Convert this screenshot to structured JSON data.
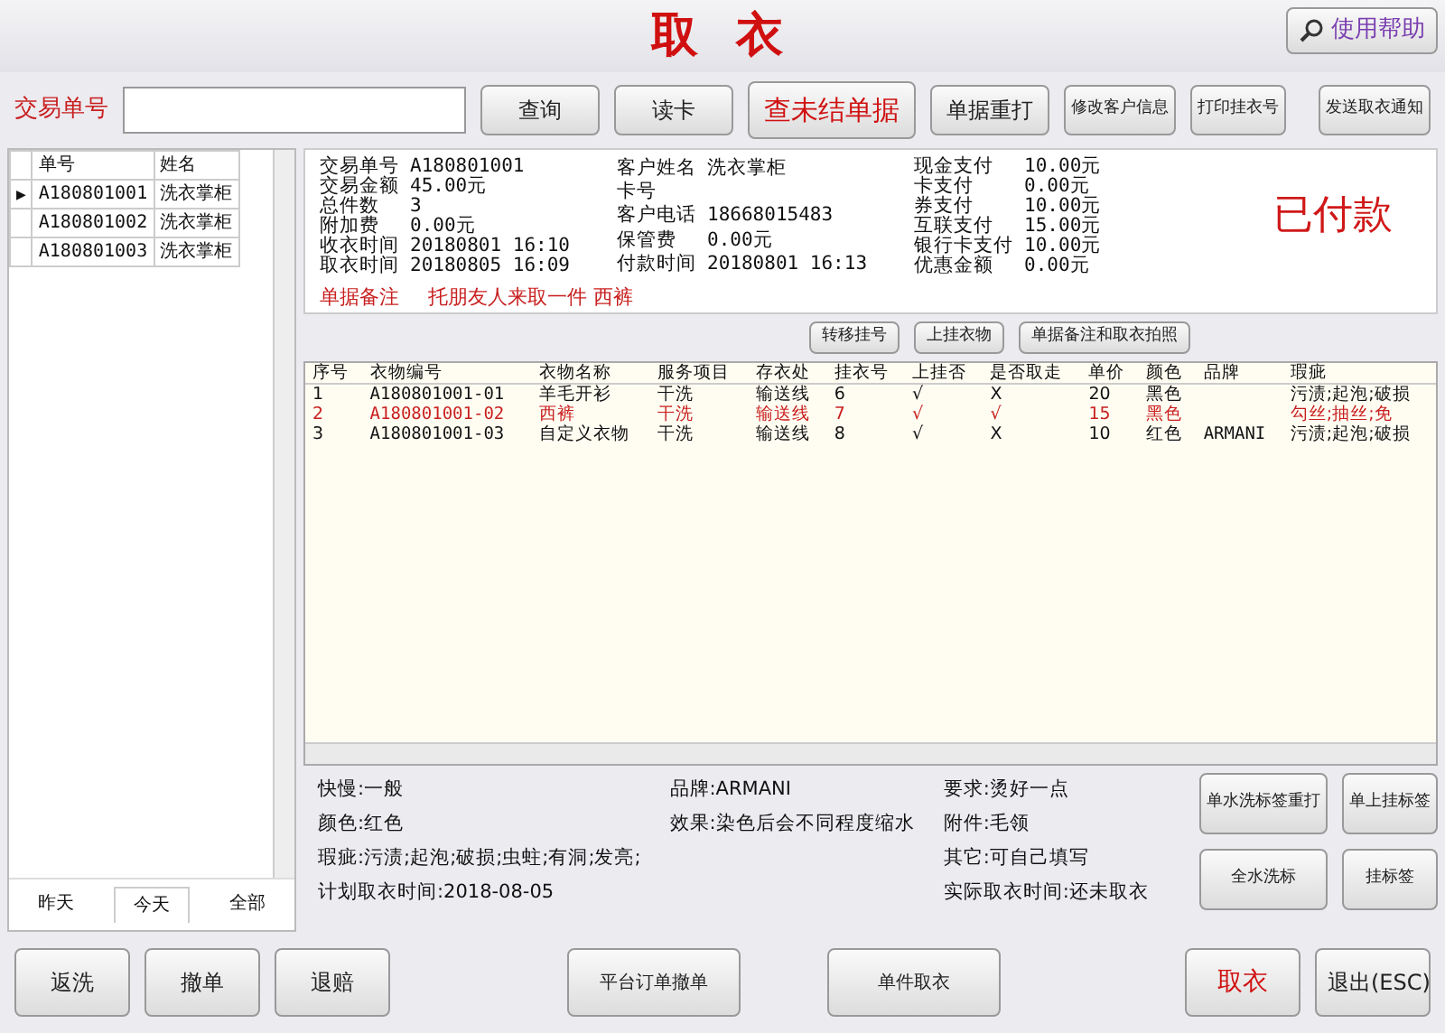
{
  "window": {
    "title": "取 衣",
    "help": "使用帮助"
  },
  "toolbar": {
    "label": "交易单号",
    "buttons": [
      {
        "label": "查询",
        "kind": "normal"
      },
      {
        "label": "读卡",
        "kind": "normal"
      },
      {
        "label": "查未结单据",
        "kind": "primary"
      },
      {
        "label": "单据重打",
        "kind": "normal"
      },
      {
        "label": "修改客户信息",
        "kind": "small"
      },
      {
        "label": "打印挂衣号",
        "kind": "small"
      },
      {
        "label": "发送取衣通知",
        "kind": "small"
      }
    ]
  },
  "order_list": {
    "pointer": "▶",
    "columns": [
      "单号",
      "姓名"
    ],
    "rows": [
      {
        "cells": [
          "A180801001",
          "洗衣掌柜"
        ],
        "selected": true
      },
      {
        "cells": [
          "A180801002",
          "洗衣掌柜"
        ],
        "selected": false
      },
      {
        "cells": [
          "A180801003",
          "洗衣掌柜"
        ],
        "selected": false
      }
    ],
    "tabs": [
      {
        "label": "昨天",
        "selected": false
      },
      {
        "label": "今天",
        "selected": true
      },
      {
        "label": "全部",
        "selected": false
      }
    ]
  },
  "info": {
    "groups": [
      [
        {
          "label": "交易单号",
          "value": "A180801001"
        },
        {
          "label": "交易金额",
          "value": "45.00元"
        },
        {
          "label": "总件数",
          "value": "3"
        },
        {
          "label": "附加费",
          "value": "0.00元"
        },
        {
          "label": "收衣时间",
          "value": "20180801 16:10"
        },
        {
          "label": "取衣时间",
          "value": "20180805 16:09"
        }
      ],
      [
        {
          "label": "客户姓名",
          "value": "洗衣掌柜"
        },
        {
          "label": "卡号"
        },
        {
          "label": "客户电话",
          "value": "18668015483"
        },
        {
          "label": "保管费",
          "value": "0.00元"
        },
        {
          "label": "付款时间",
          "value": "20180801 16:13"
        }
      ],
      [
        {
          "label": "现金支付",
          "value": "10.00元"
        },
        {
          "label": "卡支付",
          "value": "0.00元"
        },
        {
          "label": "券支付",
          "value": "10.00元"
        },
        {
          "label": "互联支付",
          "value": "15.00元"
        },
        {
          "label": "银行卡支付",
          "value": "10.00元"
        },
        {
          "label": "优惠金额",
          "value": "0.00元"
        }
      ]
    ],
    "status": "已付款",
    "note_label": "单据备注",
    "note": "托朋友人来取一件 西裤"
  },
  "item_buttons": [
    "转移挂号",
    "上挂衣物",
    "单据备注和取衣拍照"
  ],
  "items": {
    "columns": [
      "序号",
      "衣物编号",
      "衣物名称",
      "服务项目",
      "存衣处",
      "挂衣号",
      "上挂否",
      "是否取走",
      "单价",
      "颜色",
      "品牌",
      "瑕疵"
    ],
    "rows": [
      {
        "cells": [
          "1",
          "A180801001-01",
          "羊毛开衫",
          "干洗",
          "输送线",
          "6",
          "√",
          "X",
          "20",
          "黑色",
          "",
          "污渍;起泡;破损"
        ],
        "flagged": false
      },
      {
        "cells": [
          "2",
          "A180801001-02",
          "西裤",
          "干洗",
          "输送线",
          "7",
          "√",
          "√",
          "15",
          "黑色",
          "",
          "勾丝;抽丝;免"
        ],
        "flagged": true
      },
      {
        "cells": [
          "3",
          "A180801001-03",
          "自定义衣物",
          "干洗",
          "输送线",
          "8",
          "√",
          "X",
          "10",
          "红色",
          "ARMANI",
          "污渍;起泡;破损"
        ],
        "flagged": false
      }
    ]
  },
  "details": [
    [
      {
        "label": "快慢:",
        "value": "一般"
      },
      {
        "label": "颜色:",
        "value": "红色"
      },
      {
        "label": "瑕疵:",
        "value": "污渍;起泡;破损;虫蛀;有洞;发亮;"
      },
      {
        "label": "计划取衣时间:",
        "value": "2018-08-05"
      }
    ],
    [
      {
        "label": "品牌:",
        "value": "ARMANI"
      },
      {
        "label": "效果:",
        "value": "染色后会不同程度缩水"
      }
    ],
    [
      {
        "label": "要求:",
        "value": "烫好一点"
      },
      {
        "label": "附件:",
        "value": "毛领"
      },
      {
        "label": "其它:",
        "value": "可自己填写"
      },
      {
        "label": "实际取衣时间:",
        "value": "还未取衣"
      }
    ]
  ],
  "side_buttons": [
    "单水洗标签重打",
    "单上挂标签",
    "全水洗标",
    "挂标签"
  ],
  "bottom_buttons": [
    {
      "label": "返洗",
      "kind": "normal"
    },
    {
      "label": "撤单",
      "kind": "normal"
    },
    {
      "label": "退赔",
      "kind": "normal"
    },
    {
      "label": "平台订单撤单",
      "kind": "wide"
    },
    {
      "label": "单件取衣",
      "kind": "wide"
    },
    {
      "label": "取衣",
      "kind": "danger"
    },
    {
      "label": "退出(ESC)",
      "kind": "normal"
    }
  ]
}
